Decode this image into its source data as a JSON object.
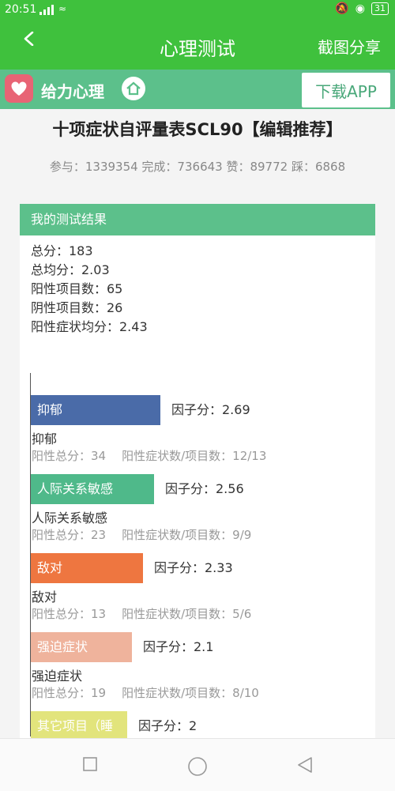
{
  "status": {
    "time": "20:51",
    "battery": "31"
  },
  "nav": {
    "title": "心理测试",
    "share": "截图分享"
  },
  "brand": {
    "name": "给力心理",
    "download": "下载APP"
  },
  "test": {
    "title": "十项症状自评量表SCL90【编辑推荐】",
    "stats": "参与：1339354 完成：736643 赞：89772 踩：6868"
  },
  "result": {
    "header": "我的测试结果",
    "summary": [
      "总分：183",
      "总均分：2.03",
      "阳性项目数：65",
      "阴性项目数：26",
      "阳性症状均分：2.43"
    ]
  },
  "factors": [
    {
      "name": "抑郁",
      "bar_label": "抑郁",
      "score_text": "因子分：2.69",
      "score": 2.69,
      "color": "#4a6ba8",
      "pos_total": "阳性总分：34",
      "ratio": "阳性症状数/项目数：12/13"
    },
    {
      "name": "人际关系敏感",
      "bar_label": "人际关系敏感",
      "score_text": "因子分：2.56",
      "score": 2.56,
      "color": "#4fb98a",
      "pos_total": "阳性总分：23",
      "ratio": "阳性症状数/项目数：9/9"
    },
    {
      "name": "敌对",
      "bar_label": "敌对",
      "score_text": "因子分：2.33",
      "score": 2.33,
      "color": "#ee7640",
      "pos_total": "阳性总分：13",
      "ratio": "阳性症状数/项目数：5/6"
    },
    {
      "name": "强迫症状",
      "bar_label": "强迫症状",
      "score_text": "因子分：2.1",
      "score": 2.1,
      "color": "#efb39c",
      "pos_total": "阳性总分：19",
      "ratio": "阳性症状数/项目数：8/10"
    },
    {
      "name": "",
      "bar_label": "其它项目（睡",
      "score_text": "因子分：2",
      "score": 2,
      "color": "#e2e47c",
      "pos_total": "",
      "ratio": ""
    }
  ]
}
